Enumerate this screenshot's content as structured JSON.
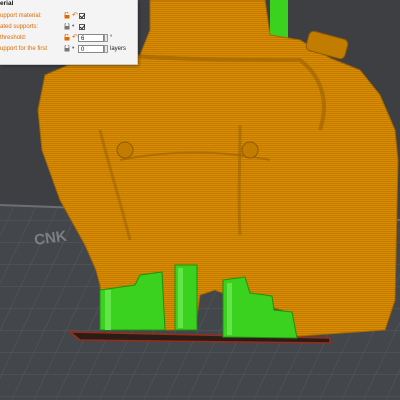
{
  "viewport": {
    "scene": "3d-print-preview",
    "colors": {
      "model": "#d98c00",
      "support": "#3bd11f",
      "bed": "#43464b",
      "background": "#3d3f43"
    },
    "bed_label": "CNK"
  },
  "panel": {
    "title": "erial",
    "rows": [
      {
        "label": "upport material:",
        "control": "checkbox",
        "checked": true
      },
      {
        "label": "ated supports:",
        "control": "checkbox",
        "checked": true
      },
      {
        "label": "threshold:",
        "control": "number",
        "value": "6",
        "unit": "°"
      },
      {
        "label": "upport for the first",
        "control": "number",
        "value": "0",
        "unit": "layers"
      }
    ]
  }
}
